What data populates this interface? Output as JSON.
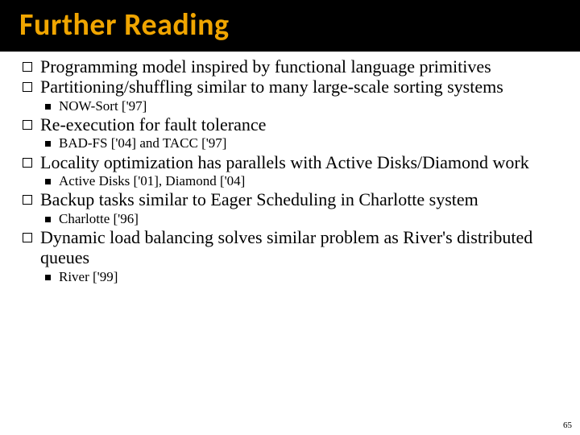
{
  "title": "Further Reading",
  "bullets": {
    "b0": {
      "text": "Programming model inspired by functional language primitives"
    },
    "b1": {
      "text": "Partitioning/shuffling similar to many large-scale sorting systems",
      "sub": "NOW-Sort ['97]"
    },
    "b2": {
      "text": "Re-execution for fault tolerance",
      "sub": "BAD-FS ['04] and TACC ['97]"
    },
    "b3": {
      "text": "Locality optimization has parallels with Active Disks/Diamond work",
      "sub": "Active Disks ['01], Diamond ['04]"
    },
    "b4": {
      "text": "Backup tasks similar to Eager Scheduling in Charlotte system",
      "sub": "Charlotte ['96]"
    },
    "b5": {
      "text": "Dynamic load balancing solves similar problem as River's distributed queues",
      "sub": "River ['99]"
    }
  },
  "pageNumber": "65"
}
